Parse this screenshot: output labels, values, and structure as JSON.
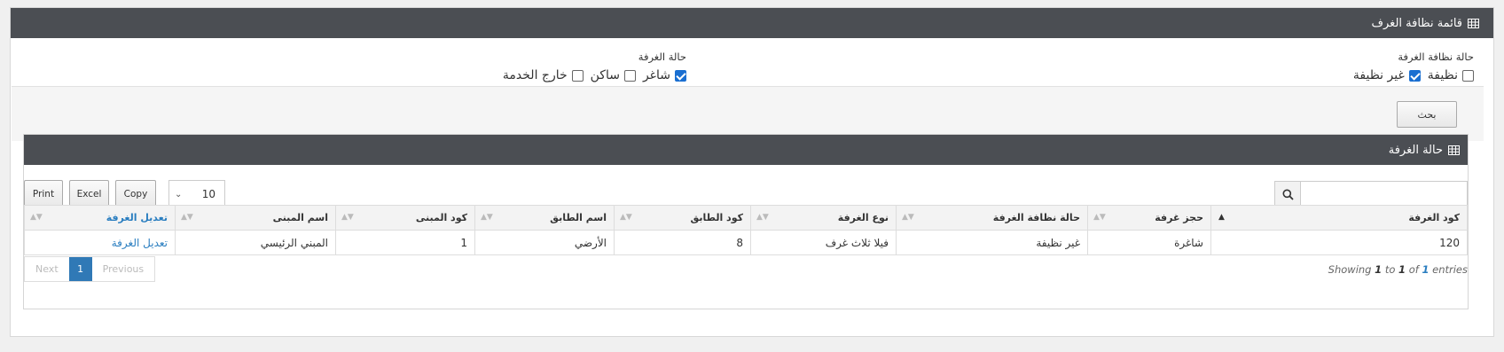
{
  "panel": {
    "title": "قائمة نظافة الغرف",
    "icon": "table-grid-icon"
  },
  "filters": {
    "cleanliness": {
      "title": "حالة نظافة الغرفة",
      "options": [
        {
          "label": "نظيفة",
          "checked": false
        },
        {
          "label": "غير نظيفة",
          "checked": true
        }
      ]
    },
    "room_status": {
      "title": "حالة الغرفة",
      "options": [
        {
          "label": "شاغر",
          "checked": true
        },
        {
          "label": "ساكن",
          "checked": false
        },
        {
          "label": "خارج الخدمة",
          "checked": false
        }
      ]
    }
  },
  "actions": {
    "search_label": "بحث"
  },
  "inner_panel": {
    "title": "حالة الغرفة",
    "icon": "table-grid-icon"
  },
  "toolbar": {
    "print_label": "Print",
    "excel_label": "Excel",
    "copy_label": "Copy",
    "page_length": "10",
    "search_placeholder": ""
  },
  "table": {
    "columns": [
      "كود الغرفة",
      "حجز غرفة",
      "حالة نظافة الغرفة",
      "نوع الغرفة",
      "كود الطابق",
      "اسم الطابق",
      "كود المبنى",
      "اسم المبنى",
      "تعديل الغرفة"
    ],
    "rows": [
      [
        "120",
        "شاغرة",
        "غير نظيفة",
        "فيلا ثلاث غرف",
        "8",
        "الأرضي",
        "1",
        "المبني الرئيسي",
        "تعديل الغرفة"
      ]
    ]
  },
  "pagination": {
    "next": "Next",
    "current": "1",
    "previous": "Previous"
  },
  "info": {
    "showing": "Showing",
    "from": "1",
    "to_word": "to",
    "to": "1",
    "of_word": "of",
    "total": "1",
    "entries": "entries"
  }
}
